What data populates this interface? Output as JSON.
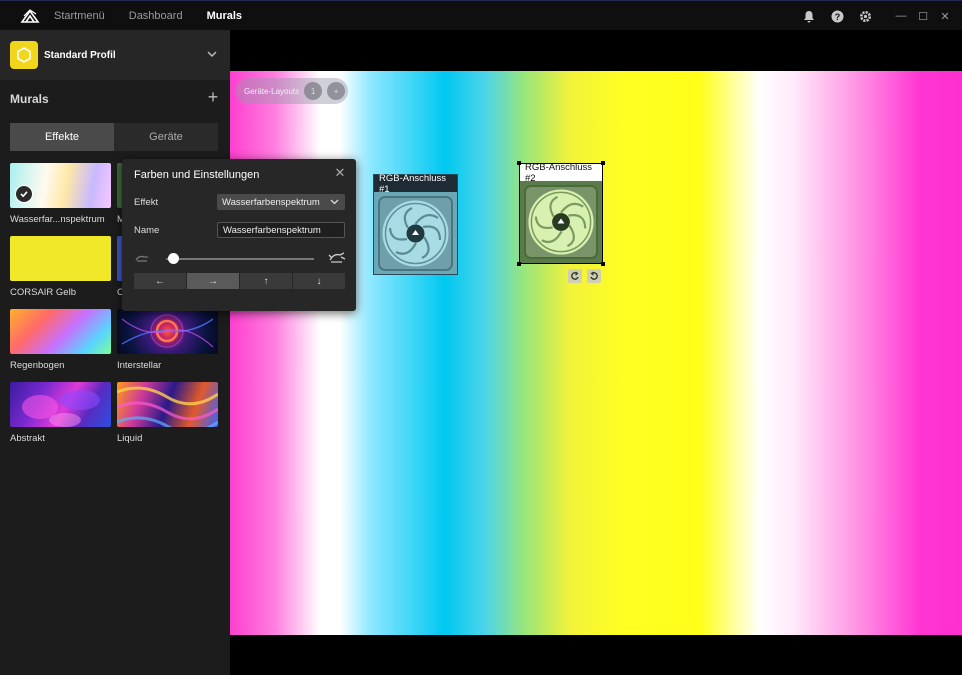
{
  "nav": {
    "items": [
      {
        "label": "Startmenü",
        "active": false
      },
      {
        "label": "Dashboard",
        "active": false
      },
      {
        "label": "Murals",
        "active": true
      }
    ]
  },
  "window": {
    "icons": [
      "bell-icon",
      "help-icon",
      "gear-icon"
    ],
    "controls": {
      "minimize": "—",
      "maximize": "☐",
      "close": "✕"
    }
  },
  "profile": {
    "name": "Standard Profil",
    "badge_color": "#f2d61b"
  },
  "sidebar": {
    "section_title": "Murals",
    "tabs": [
      {
        "label": "Effekte",
        "active": true
      },
      {
        "label": "Geräte",
        "active": false
      }
    ],
    "effects": [
      {
        "label": "Wasserfar...nspektrum",
        "selected": true
      },
      {
        "label": "M",
        "selected": false
      },
      {
        "label": "CORSAIR Gelb",
        "selected": false
      },
      {
        "label": "C",
        "selected": false
      },
      {
        "label": "Regenbogen",
        "selected": false
      },
      {
        "label": "Interstellar",
        "selected": false
      },
      {
        "label": "Abstrakt",
        "selected": false
      },
      {
        "label": "Liquid",
        "selected": false
      }
    ]
  },
  "canvas": {
    "layouts_label": "Geräte-Layouts",
    "layouts_count": "1",
    "layouts_add": "+",
    "devices": [
      {
        "title": "RGB-Anschluss #1",
        "selected": false
      },
      {
        "title": "RGB-Anschluss #2",
        "selected": true
      }
    ]
  },
  "dialog": {
    "title": "Farben und Einstellungen",
    "effect_label": "Effekt",
    "effect_value": "Wasserfarbenspektrum",
    "name_label": "Name",
    "name_value": "Wasserfarbenspektrum",
    "speed_fraction": 0.05,
    "directions": [
      "←",
      "→",
      "↑",
      "↓"
    ],
    "active_direction": "→"
  }
}
